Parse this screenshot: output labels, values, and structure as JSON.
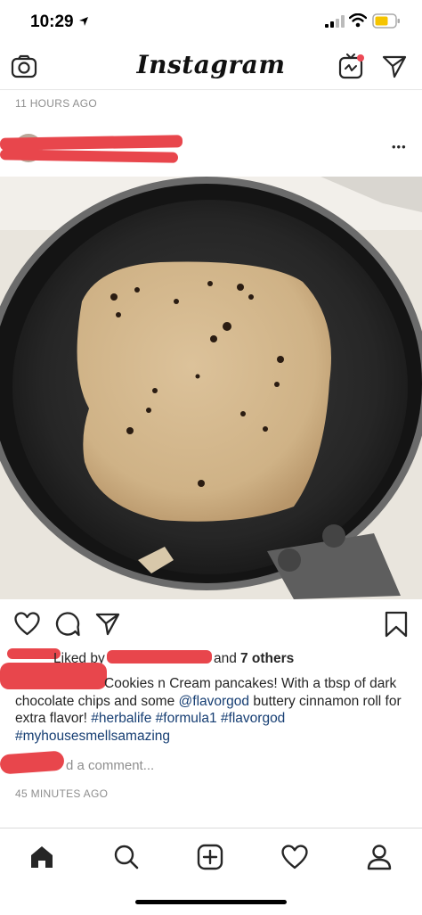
{
  "status_bar": {
    "time": "10:29"
  },
  "header": {
    "title": "Instagram"
  },
  "previous_post": {
    "timestamp": "11 HOURS AGO"
  },
  "post": {
    "more_label": "•••",
    "likes": {
      "prefix": "Liked by",
      "and_label": "and",
      "others": "7 others"
    },
    "caption": {
      "text_start": "Cookies n Cream pancakes! With a tbsp of dark chocolate chips and some ",
      "mention": "@flavorgod",
      "text_mid": " buttery cinnamon roll for extra flavor! ",
      "tags": [
        "#herbalife",
        "#formula1",
        "#flavorgod",
        "#myhousesmellsamazing"
      ]
    },
    "comment_placeholder": "Add a comment...",
    "comment_visible": "d a comment...",
    "timestamp": "45 MINUTES AGO"
  },
  "colors": {
    "accent_red": "#ed4956",
    "link": "#163e73",
    "gray": "#8e8e8e"
  },
  "icons": [
    "camera-icon",
    "igtv-icon",
    "direct-icon",
    "more-icon",
    "heart-icon",
    "comment-icon",
    "share-icon",
    "bookmark-icon",
    "home-icon",
    "search-icon",
    "new-post-icon",
    "activity-icon",
    "profile-icon",
    "wifi-icon",
    "battery-icon",
    "signal-icon",
    "location-arrow-icon"
  ]
}
